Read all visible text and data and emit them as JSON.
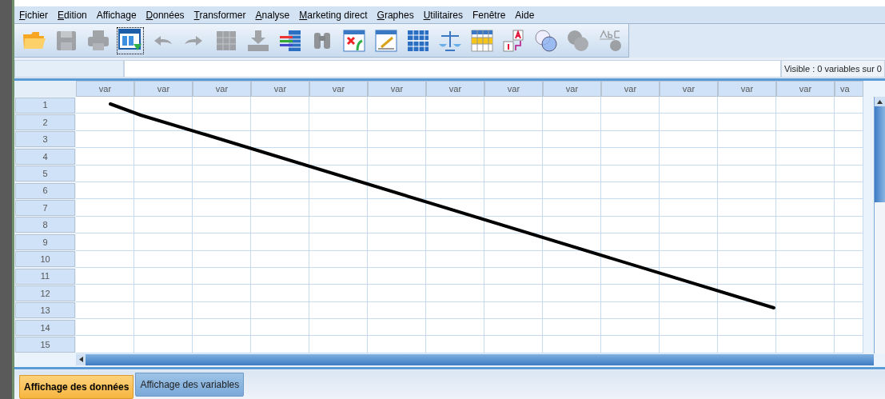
{
  "menu": [
    {
      "label": "Fichier",
      "underline_first": true
    },
    {
      "label": "Edition",
      "underline_first": true
    },
    {
      "label": "Affichage",
      "underline_first": false
    },
    {
      "label": "Données",
      "underline_first": true
    },
    {
      "label": "Transformer",
      "underline_first": true
    },
    {
      "label": "Analyse",
      "underline_first": true
    },
    {
      "label": "Marketing direct",
      "underline_first": true
    },
    {
      "label": "Graphes",
      "underline_first": true
    },
    {
      "label": "Utilitaires",
      "underline_first": true
    },
    {
      "label": "Fenêtre",
      "underline_first": false
    },
    {
      "label": "Aide",
      "underline_first": false
    }
  ],
  "toolbar": [
    {
      "kind": "open",
      "disabled": false,
      "focused": false
    },
    {
      "kind": "save",
      "disabled": true,
      "focused": false
    },
    {
      "kind": "print",
      "disabled": true,
      "focused": false
    },
    {
      "kind": "dialog",
      "disabled": false,
      "focused": true
    },
    {
      "kind": "undo",
      "disabled": true,
      "focused": false
    },
    {
      "kind": "redo",
      "disabled": true,
      "focused": false
    },
    {
      "kind": "goto",
      "disabled": true,
      "focused": false
    },
    {
      "kind": "insert",
      "disabled": true,
      "focused": false
    },
    {
      "kind": "variables",
      "disabled": false,
      "focused": false
    },
    {
      "kind": "find",
      "disabled": true,
      "focused": false
    },
    {
      "kind": "insertvar",
      "disabled": false,
      "focused": false
    },
    {
      "kind": "split",
      "disabled": false,
      "focused": false
    },
    {
      "kind": "table",
      "disabled": false,
      "focused": false
    },
    {
      "kind": "weight",
      "disabled": false,
      "focused": false
    },
    {
      "kind": "grid",
      "disabled": false,
      "focused": false
    },
    {
      "kind": "labels",
      "disabled": false,
      "focused": false
    },
    {
      "kind": "sets",
      "disabled": false,
      "focused": false
    },
    {
      "kind": "sets",
      "disabled": true,
      "focused": false
    },
    {
      "kind": "spell",
      "disabled": true,
      "focused": false
    }
  ],
  "cell_editor": {
    "status": "Visible : 0 variables sur 0"
  },
  "grid": {
    "columns": [
      "var",
      "var",
      "var",
      "var",
      "var",
      "var",
      "var",
      "var",
      "var",
      "var",
      "var",
      "var",
      "var",
      "va"
    ],
    "rows": [
      "1",
      "2",
      "3",
      "4",
      "5",
      "6",
      "7",
      "8",
      "9",
      "10",
      "11",
      "12",
      "13",
      "14",
      "15"
    ]
  },
  "tabs": [
    {
      "label": "Affichage des données",
      "selected": true
    },
    {
      "label": "Affichage des variables",
      "selected": false
    }
  ]
}
